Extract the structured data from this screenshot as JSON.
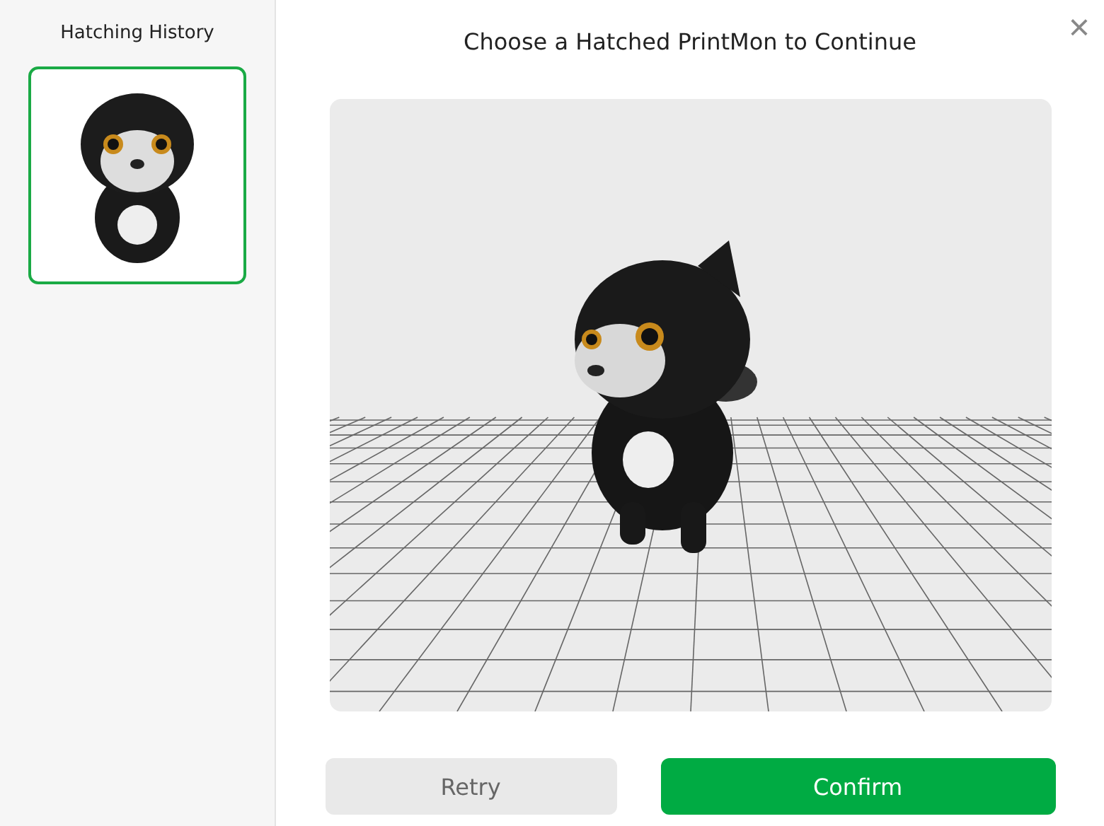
{
  "sidebar": {
    "title": "Hatching History",
    "items": [
      {
        "selected": true
      }
    ]
  },
  "dialog": {
    "title": "Choose a Hatched PrintMon to Continue",
    "close": "×"
  },
  "buttons": [
    {
      "label": "Retry",
      "kind": "secondary"
    },
    {
      "label": "Confirm",
      "kind": "primary"
    }
  ]
}
